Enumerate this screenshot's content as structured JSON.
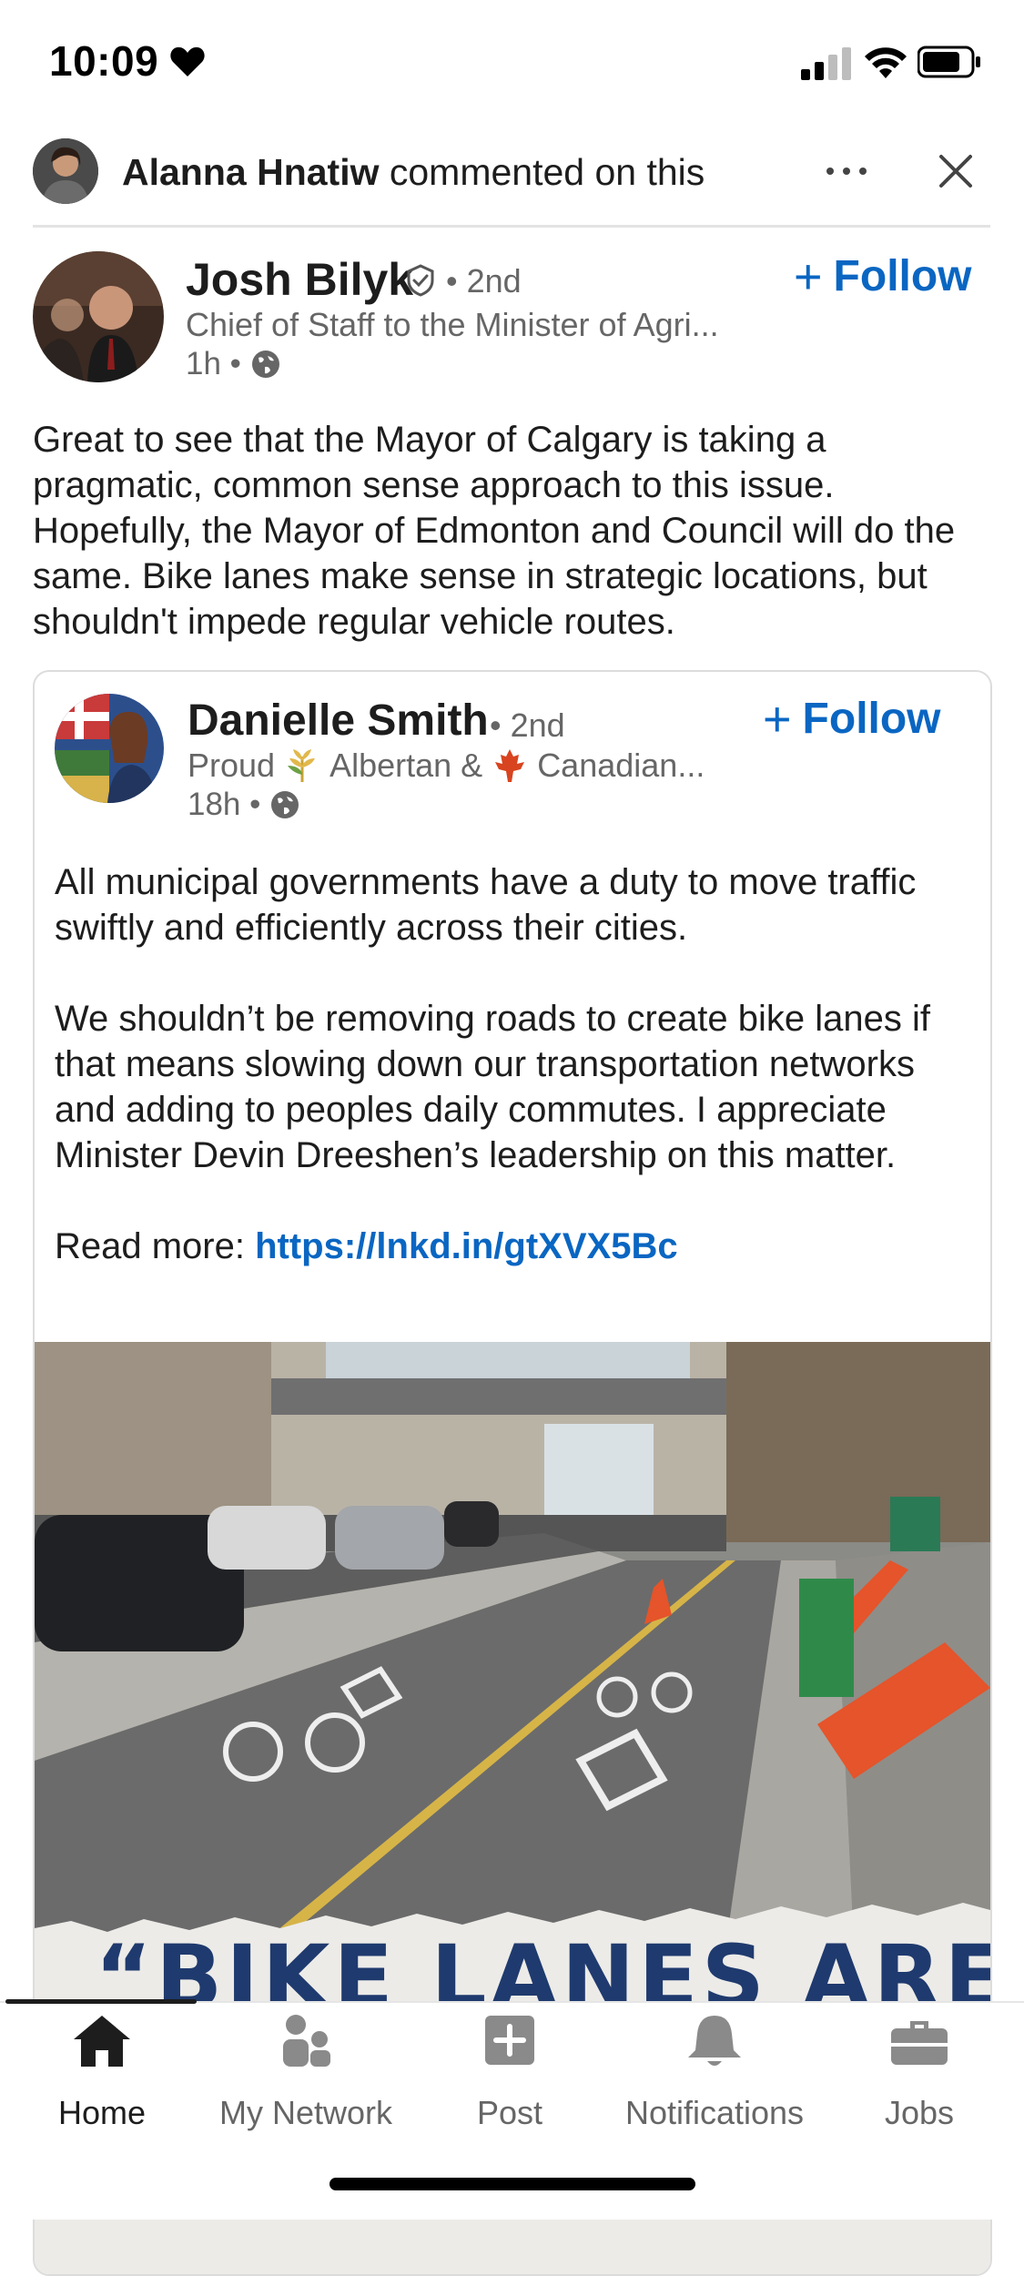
{
  "status_bar": {
    "time": "10:09",
    "heart_icon": "heart-icon",
    "signal_icon": "signal-icon",
    "wifi_icon": "wifi-icon",
    "battery_icon": "battery-icon"
  },
  "activity": {
    "actor": "Alanna Hnatiw",
    "action": " commented on this",
    "more_icon": "more-horizontal-icon",
    "close_icon": "close-icon"
  },
  "post": {
    "author": "Josh Bilyk",
    "verified_icon": "verified-icon",
    "degree": "• 2nd",
    "headline": "Chief of Staff to the Minister of Agri...",
    "time": "1h •",
    "follow_label": "Follow",
    "body": "Great to see that the Mayor of Calgary is taking a pragmatic, common sense approach to this issue. Hopefully, the Mayor of Edmonton and Council will do the same. Bike lanes make sense in strategic locations, but shouldn't impede regular vehicle routes."
  },
  "shared": {
    "author": "Danielle Smith",
    "degree": "• 2nd",
    "headline_a": "Proud",
    "headline_b": "Albertan &",
    "headline_c": "Canadian...",
    "time": "18h •",
    "follow_label": "Follow",
    "para1": "All municipal governments have a  duty to move traffic swiftly and efficiently across their cities.",
    "para2": "We shouldn’t be removing roads to create bike lanes if that means slowing down our transportation networks and adding to peoples daily commutes. I appreciate Minister Devin Dreeshen’s leadership on this matter.",
    "read_more_label": "Read more: ",
    "link": "https://lnkd.in/gtXVX5Bc",
    "banner_text": "“BIKE LANES ARE"
  },
  "bottom_nav": {
    "items": [
      {
        "label": "Home",
        "icon": "home-icon",
        "active": true
      },
      {
        "label": "My Network",
        "icon": "network-icon",
        "active": false
      },
      {
        "label": "Post",
        "icon": "post-icon",
        "active": false
      },
      {
        "label": "Notifications",
        "icon": "bell-icon",
        "active": false
      },
      {
        "label": "Jobs",
        "icon": "briefcase-icon",
        "active": false
      }
    ]
  },
  "colors": {
    "accent": "#0a66c2",
    "text": "#1d1d1d",
    "muted": "#666666",
    "banner_text": "#1f3a6e"
  }
}
